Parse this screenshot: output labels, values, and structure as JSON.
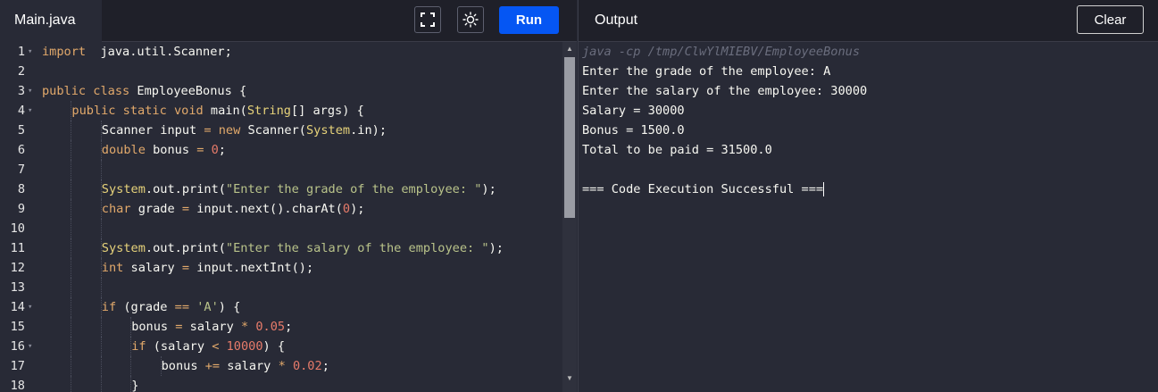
{
  "editor": {
    "file_tab": "Main.java",
    "run_label": "Run",
    "icons": {
      "fullscreen": "fullscreen-icon",
      "theme": "sun-icon"
    },
    "lines": [
      {
        "n": "1",
        "fold": true,
        "indent": 0,
        "tokens": [
          [
            "kw",
            "import"
          ],
          [
            "",
            "  java.util.Scanner;"
          ]
        ]
      },
      {
        "n": "2",
        "fold": false,
        "indent": 0,
        "tokens": []
      },
      {
        "n": "3",
        "fold": true,
        "indent": 0,
        "tokens": [
          [
            "kw",
            "public class"
          ],
          [
            "",
            " EmployeeBonus {"
          ]
        ]
      },
      {
        "n": "4",
        "fold": true,
        "indent": 1,
        "tokens": [
          [
            "kw",
            "public static void"
          ],
          [
            "",
            " main("
          ],
          [
            "ty",
            "String"
          ],
          [
            "",
            "[] args) {"
          ]
        ]
      },
      {
        "n": "5",
        "fold": false,
        "indent": 2,
        "tokens": [
          [
            "",
            "Scanner input "
          ],
          [
            "op",
            "="
          ],
          [
            "",
            " "
          ],
          [
            "kw",
            "new"
          ],
          [
            "",
            " Scanner("
          ],
          [
            "ty",
            "System"
          ],
          [
            "",
            ".in);"
          ]
        ]
      },
      {
        "n": "6",
        "fold": false,
        "indent": 2,
        "tokens": [
          [
            "kw",
            "double"
          ],
          [
            "",
            " bonus "
          ],
          [
            "op",
            "="
          ],
          [
            "",
            " "
          ],
          [
            "num",
            "0"
          ],
          [
            "",
            ";"
          ]
        ]
      },
      {
        "n": "7",
        "fold": false,
        "indent": 2,
        "tokens": []
      },
      {
        "n": "8",
        "fold": false,
        "indent": 2,
        "tokens": [
          [
            "ty",
            "System"
          ],
          [
            "",
            ".out.print("
          ],
          [
            "str",
            "\"Enter the grade of the employee: \""
          ],
          [
            "",
            ");"
          ]
        ]
      },
      {
        "n": "9",
        "fold": false,
        "indent": 2,
        "tokens": [
          [
            "kw",
            "char"
          ],
          [
            "",
            " grade "
          ],
          [
            "op",
            "="
          ],
          [
            "",
            " input.next().charAt("
          ],
          [
            "num",
            "0"
          ],
          [
            "",
            ");"
          ]
        ]
      },
      {
        "n": "10",
        "fold": false,
        "indent": 2,
        "tokens": []
      },
      {
        "n": "11",
        "fold": false,
        "indent": 2,
        "tokens": [
          [
            "ty",
            "System"
          ],
          [
            "",
            ".out.print("
          ],
          [
            "str",
            "\"Enter the salary of the employee: \""
          ],
          [
            "",
            ");"
          ]
        ]
      },
      {
        "n": "12",
        "fold": false,
        "indent": 2,
        "tokens": [
          [
            "kw",
            "int"
          ],
          [
            "",
            " salary "
          ],
          [
            "op",
            "="
          ],
          [
            "",
            " input.nextInt();"
          ]
        ]
      },
      {
        "n": "13",
        "fold": false,
        "indent": 2,
        "tokens": []
      },
      {
        "n": "14",
        "fold": true,
        "indent": 2,
        "tokens": [
          [
            "kw",
            "if"
          ],
          [
            "",
            " (grade "
          ],
          [
            "op",
            "=="
          ],
          [
            "",
            " "
          ],
          [
            "str",
            "'A'"
          ],
          [
            "",
            ") {"
          ]
        ]
      },
      {
        "n": "15",
        "fold": false,
        "indent": 3,
        "tokens": [
          [
            "",
            "bonus "
          ],
          [
            "op",
            "="
          ],
          [
            "",
            " salary "
          ],
          [
            "op",
            "*"
          ],
          [
            "",
            " "
          ],
          [
            "num",
            "0.05"
          ],
          [
            "",
            ";"
          ]
        ]
      },
      {
        "n": "16",
        "fold": true,
        "indent": 3,
        "tokens": [
          [
            "kw",
            "if"
          ],
          [
            "",
            " (salary "
          ],
          [
            "op",
            "<"
          ],
          [
            "",
            " "
          ],
          [
            "num",
            "10000"
          ],
          [
            "",
            ") {"
          ]
        ]
      },
      {
        "n": "17",
        "fold": false,
        "indent": 4,
        "tokens": [
          [
            "",
            "bonus "
          ],
          [
            "op",
            "+="
          ],
          [
            "",
            " salary "
          ],
          [
            "op",
            "*"
          ],
          [
            "",
            " "
          ],
          [
            "num",
            "0.02"
          ],
          [
            "",
            ";"
          ]
        ]
      },
      {
        "n": "18",
        "fold": false,
        "indent": 3,
        "tokens": [
          [
            "",
            "}"
          ]
        ]
      }
    ]
  },
  "output": {
    "title": "Output",
    "clear_label": "Clear",
    "command": "java -cp /tmp/ClwYlMIEBV/EmployeeBonus",
    "lines": [
      "Enter the grade of the employee: A",
      "Enter the salary of the employee: 30000",
      "Salary = 30000",
      "Bonus = 1500.0",
      "Total to be paid = 31500.0",
      "",
      "=== Code Execution Successful ==="
    ]
  },
  "colors": {
    "background": "#282a36",
    "header": "#1f2029",
    "run_button": "#0556f3",
    "keyword": "#e2a96b",
    "type": "#e6d27a",
    "string": "#b9c38a",
    "number": "#e77b6a"
  }
}
